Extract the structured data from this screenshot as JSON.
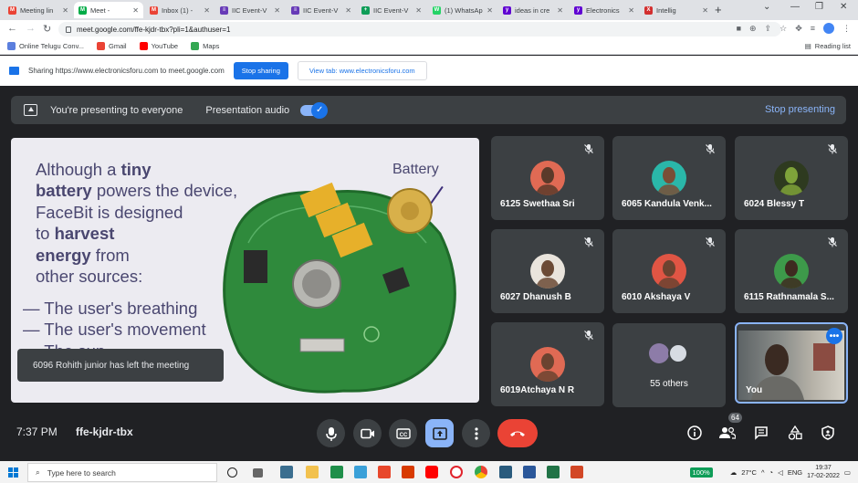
{
  "browser": {
    "tabs": [
      {
        "title": "Meeting lin",
        "color": "#ea4335",
        "letter": "M"
      },
      {
        "title": "Meet -",
        "color": "#00ac47",
        "letter": "M"
      },
      {
        "title": "Inbox (1) -",
        "color": "#ea4335",
        "letter": "M"
      },
      {
        "title": "IIC Event-V",
        "color": "#673ab7",
        "letter": "≡"
      },
      {
        "title": "IIC Event-V",
        "color": "#673ab7",
        "letter": "≡"
      },
      {
        "title": "IIC Event-V",
        "color": "#0f9d58",
        "letter": "+"
      },
      {
        "title": "(1) WhatsAp",
        "color": "#25d366",
        "letter": "W"
      },
      {
        "title": "ideas in cre",
        "color": "#6001d2",
        "letter": "y"
      },
      {
        "title": "Electronics",
        "color": "#6001d2",
        "letter": "y"
      },
      {
        "title": "Intellig",
        "color": "#d32f2f",
        "letter": "X"
      }
    ],
    "url": "meet.google.com/ffe-kjdr-tbx?pli=1&authuser=1",
    "bookmarks": [
      {
        "label": "Online Telugu Conv...",
        "color": "#5b7fde"
      },
      {
        "label": "Gmail",
        "color": "#ea4335"
      },
      {
        "label": "YouTube",
        "color": "#ff0000"
      },
      {
        "label": "Maps",
        "color": "#34a853"
      }
    ],
    "reading_list": "Reading list"
  },
  "sharebar": {
    "text": "Sharing https://www.electronicsforu.com to meet.google.com",
    "stop_sharing": "Stop sharing",
    "view_tab": "View tab: www.electronicsforu.com"
  },
  "meet": {
    "presenting_text": "You're presenting to everyone",
    "presentation_audio": "Presentation audio",
    "stop_presenting": "Stop presenting",
    "slide": {
      "line1_a": "Although a ",
      "line1_b": "tiny",
      "line2_a": "battery",
      "line2_b": " powers the device,",
      "line3": "FaceBit is designed",
      "line4_a": "to ",
      "line4_b": "harvest",
      "line5_a": "energy",
      "line5_b": " from",
      "line6": "other sources:",
      "bullet1": "— The user's breathing",
      "bullet2": "— The user's movement",
      "bullet3": "— The sun",
      "battery_label": "Battery"
    },
    "toast": "6096 Rohith junior has left the meeting",
    "participants": [
      {
        "name": "6125 Swethaa Sri",
        "avatar_bg": "#e06a54",
        "skin": "#5b3a2a"
      },
      {
        "name": "6065 Kandula Venk...",
        "avatar_bg": "#2ab7a9",
        "skin": "#7a4e36"
      },
      {
        "name": "6024 Blessy T",
        "avatar_bg": "#2e3a1f",
        "skin": "#7fa33a"
      },
      {
        "name": "6027 Dhanush B",
        "avatar_bg": "#e9e4dc",
        "skin": "#6b4a35"
      },
      {
        "name": "6010 Akshaya V",
        "avatar_bg": "#e05544",
        "skin": "#6b4330"
      },
      {
        "name": "6115 Rathnamala S...",
        "avatar_bg": "#3d9a4a",
        "skin": "#3e2a20"
      },
      {
        "name": "6019Atchaya N R",
        "avatar_bg": "#e06a54",
        "skin": "#6b4330"
      }
    ],
    "others_label": "55 others",
    "you_label": "You",
    "time": "7:37 PM",
    "meeting_code": "ffe-kjdr-tbx",
    "people_count": "64"
  },
  "taskbar": {
    "search_placeholder": "Type here to search",
    "battery_percent": "100%",
    "temperature": "27°C",
    "language": "ENG",
    "clock_time": "19:37",
    "clock_date": "17-02-2022"
  }
}
